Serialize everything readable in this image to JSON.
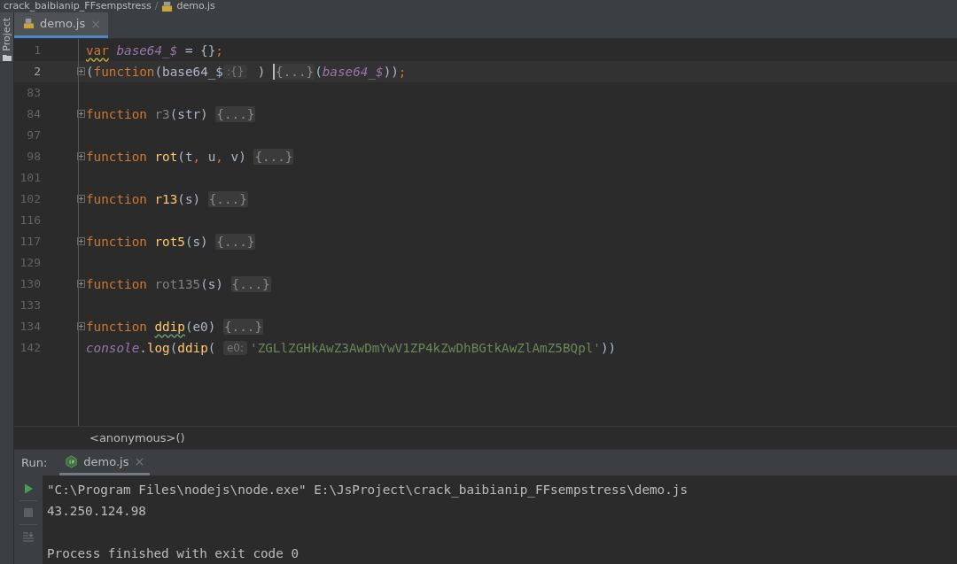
{
  "breadcrumb": {
    "folder": "crack_baibianip_FFsempstress",
    "separator": "/",
    "file": "demo.js"
  },
  "sidebar": {
    "label": "Project"
  },
  "tabs": [
    {
      "label": "demo.js",
      "close": "×",
      "selected": true
    }
  ],
  "lines": [
    {
      "number": "1",
      "current": false,
      "foldable": false,
      "tokens": [
        {
          "kind": "kw",
          "text": "var",
          "warning": true
        },
        {
          "kind": "global",
          "text": " base64_$"
        },
        {
          "kind": "plain",
          "text": " = {}"
        },
        {
          "kind": "kw",
          "text": ";"
        }
      ]
    },
    {
      "number": "2",
      "current": true,
      "foldable": true,
      "tokens": [
        {
          "kind": "plain",
          "text": "("
        },
        {
          "kind": "kw",
          "text": "function"
        },
        {
          "kind": "plain",
          "text": "(base64_$"
        },
        {
          "kind": "hint",
          "text": ":{}"
        },
        {
          "kind": "plain",
          "text": " ) "
        },
        {
          "kind": "fold",
          "text": "{...}",
          "caret": true
        },
        {
          "kind": "plain",
          "text": "("
        },
        {
          "kind": "global",
          "text": "base64_$"
        },
        {
          "kind": "plain",
          "text": "))"
        },
        {
          "kind": "kw",
          "text": ";"
        }
      ]
    },
    {
      "number": "83",
      "current": false,
      "foldable": false
    },
    {
      "number": "84",
      "current": false,
      "foldable": true,
      "tokens": [
        {
          "kind": "kw",
          "text": "function "
        },
        {
          "kind": "dim",
          "text": "r3"
        },
        {
          "kind": "plain",
          "text": "(str) "
        },
        {
          "kind": "fold",
          "text": "{...}"
        }
      ]
    },
    {
      "number": "97",
      "current": false,
      "foldable": false
    },
    {
      "number": "98",
      "current": false,
      "foldable": true,
      "tokens": [
        {
          "kind": "kw",
          "text": "function "
        },
        {
          "kind": "fn",
          "text": "rot"
        },
        {
          "kind": "plain",
          "text": "(t"
        },
        {
          "kind": "kw",
          "text": ","
        },
        {
          "kind": "plain",
          "text": " u"
        },
        {
          "kind": "kw",
          "text": ","
        },
        {
          "kind": "plain",
          "text": " v) "
        },
        {
          "kind": "fold",
          "text": "{...}"
        }
      ]
    },
    {
      "number": "101",
      "current": false,
      "foldable": false
    },
    {
      "number": "102",
      "current": false,
      "foldable": true,
      "tokens": [
        {
          "kind": "kw",
          "text": "function "
        },
        {
          "kind": "fn",
          "text": "r13"
        },
        {
          "kind": "plain",
          "text": "(s) "
        },
        {
          "kind": "fold",
          "text": "{...}"
        }
      ]
    },
    {
      "number": "116",
      "current": false,
      "foldable": false
    },
    {
      "number": "117",
      "current": false,
      "foldable": true,
      "tokens": [
        {
          "kind": "kw",
          "text": "function "
        },
        {
          "kind": "fn",
          "text": "rot5"
        },
        {
          "kind": "plain",
          "text": "(s) "
        },
        {
          "kind": "fold",
          "text": "{...}"
        }
      ]
    },
    {
      "number": "129",
      "current": false,
      "foldable": false
    },
    {
      "number": "130",
      "current": false,
      "foldable": true,
      "tokens": [
        {
          "kind": "kw",
          "text": "function "
        },
        {
          "kind": "dim",
          "text": "rot135"
        },
        {
          "kind": "plain",
          "text": "(s) "
        },
        {
          "kind": "fold",
          "text": "{...}"
        }
      ]
    },
    {
      "number": "133",
      "current": false,
      "foldable": false
    },
    {
      "number": "134",
      "current": false,
      "foldable": true,
      "tokens": [
        {
          "kind": "kw",
          "text": "function "
        },
        {
          "kind": "fn",
          "text": "ddip",
          "typo": true
        },
        {
          "kind": "plain",
          "text": "(e0) "
        },
        {
          "kind": "fold",
          "text": "{...}"
        }
      ]
    },
    {
      "number": "142",
      "current": false,
      "foldable": false,
      "tokens": [
        {
          "kind": "global",
          "text": "console"
        },
        {
          "kind": "plain",
          "text": "."
        },
        {
          "kind": "fn",
          "text": "log"
        },
        {
          "kind": "plain",
          "text": "("
        },
        {
          "kind": "fn",
          "text": "ddip"
        },
        {
          "kind": "plain",
          "text": "( "
        },
        {
          "kind": "hint",
          "text": "e0:"
        },
        {
          "kind": "str",
          "text": "'ZGLlZGHkAwZ3AwDmYwV1ZP4kZwDhBGtkAwZlAmZ5BQpl'"
        },
        {
          "kind": "plain",
          "text": "))"
        }
      ]
    }
  ],
  "code_breadcrumb": "<anonymous>()",
  "run": {
    "label": "Run:",
    "tabs": [
      {
        "label": "demo.js",
        "close": "×",
        "selected": true
      }
    ],
    "output": [
      {
        "kind": "command",
        "text": "\"C:\\Program Files\\nodejs\\node.exe\" E:\\JsProject\\crack_baibianip_FFsempstress\\demo.js"
      },
      {
        "kind": "output",
        "text": "43.250.124.98"
      },
      {
        "kind": "exit",
        "text": "Process finished with exit code 0"
      }
    ]
  }
}
